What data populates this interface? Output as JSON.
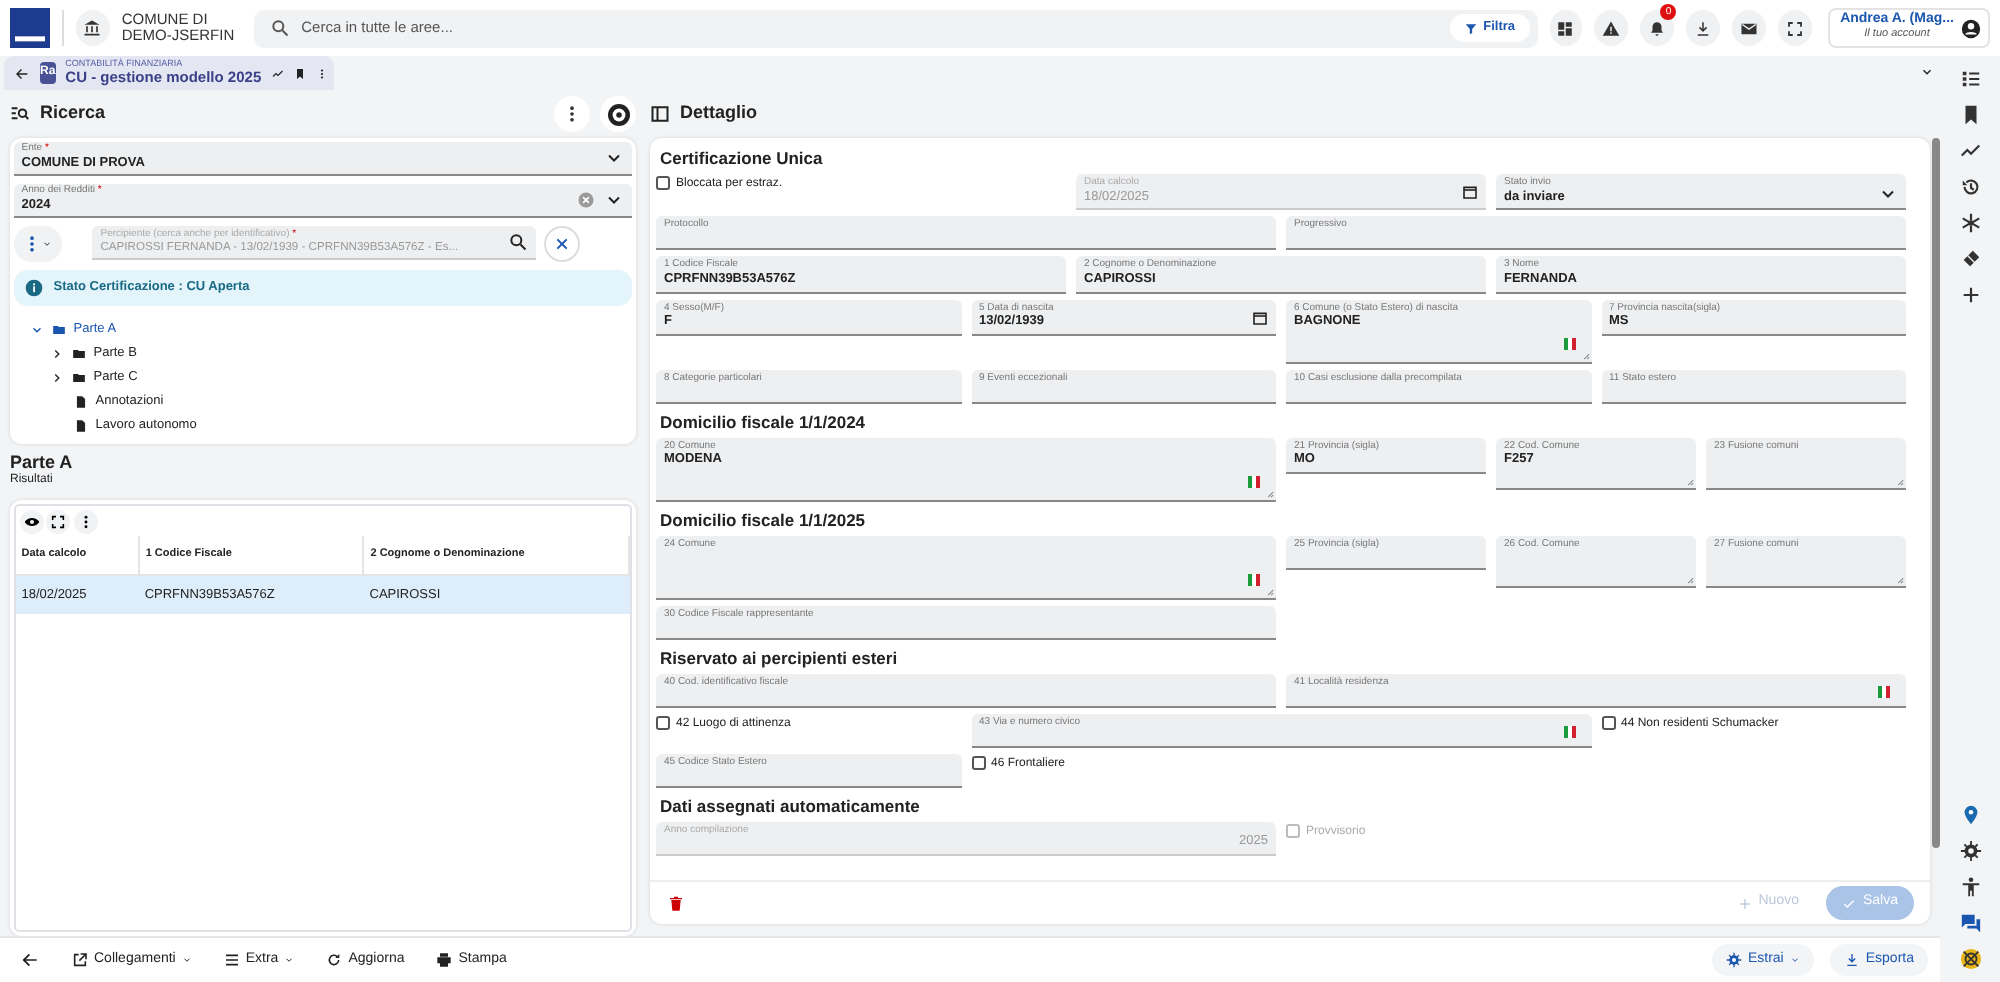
{
  "header": {
    "org_line1": "COMUNE DI",
    "org_line2": "DEMO-JSERFIN",
    "search_placeholder": "Cerca in tutte le aree...",
    "filter_label": "Filtra",
    "notification_count": "0",
    "user_name": "Andrea A. (Mag...",
    "user_subtitle": "Il tuo account"
  },
  "app_tab": {
    "badge": "Ra",
    "category": "CONTABILITÀ FINANZIARIA",
    "title": "CU - gestione modello 2025"
  },
  "search_panel": {
    "title": "Ricerca",
    "ente": {
      "label": "Ente",
      "mark": "*",
      "value": "COMUNE DI PROVA"
    },
    "anno": {
      "label": "Anno dei Redditi",
      "mark": "*",
      "value": "2024"
    },
    "percipiente": {
      "label": "Percipiente (cerca anche per identificativo)",
      "mark": "*",
      "value": "CAPIROSSI FERNANDA - 13/02/1939 - CPRFNN39B53A576Z - Es...",
      "disabled": true
    },
    "status": "Stato Certificazione : CU Aperta",
    "tree": [
      {
        "label": "Parte A",
        "kind": "folder",
        "expanded": true,
        "selected": true,
        "children": [
          {
            "label": "Parte B",
            "kind": "folder",
            "expanded": false,
            "selected": false
          },
          {
            "label": "Parte C",
            "kind": "folder",
            "expanded": false,
            "selected": false
          },
          {
            "label": "Annotazioni",
            "kind": "file",
            "selected": false
          },
          {
            "label": "Lavoro autonomo",
            "kind": "file",
            "selected": false
          }
        ]
      }
    ]
  },
  "results": {
    "title": "Parte A",
    "subtitle": "Risultati",
    "columns": [
      "Data calcolo",
      "1 Codice Fiscale",
      "2 Cognome o Denominazione"
    ],
    "rows": [
      {
        "cells": [
          "18/02/2025",
          "CPRFNN39B53A576Z",
          "CAPIROSSI"
        ],
        "selected": true
      }
    ]
  },
  "detail": {
    "title": "Dettaglio",
    "sections": [
      {
        "heading": "Certificazione Unica",
        "rows": [
          [
            {
              "kind": "checkbox",
              "label": "Bloccata per estraz.",
              "checked": false,
              "disabled": false
            },
            {
              "kind": "date",
              "label": "Data calcolo",
              "value": "18/02/2025",
              "disabled": true
            },
            {
              "kind": "select",
              "label": "Stato invio",
              "value": "da inviare",
              "disabled": false
            }
          ],
          [
            {
              "kind": "text",
              "label": "Protocollo",
              "disabled": false
            },
            {
              "kind": "text",
              "label": "Progressivo",
              "disabled": false
            }
          ],
          [
            {
              "kind": "text",
              "label": "1 Codice Fiscale",
              "value": "CPRFNN39B53A576Z",
              "disabled": false
            },
            {
              "kind": "text",
              "label": "2 Cognome o Denominazione",
              "value": "CAPIROSSI",
              "disabled": false
            },
            {
              "kind": "text",
              "label": "3 Nome",
              "value": "FERNANDA",
              "disabled": false
            }
          ],
          [
            {
              "kind": "text",
              "label": "4 Sesso(M/F)",
              "value": "F",
              "disabled": false
            },
            {
              "kind": "date",
              "label": "5 Data di nascita",
              "value": "13/02/1939",
              "disabled": false
            },
            {
              "kind": "textarea-flag",
              "label": "6 Comune (o Stato Estero) di nascita",
              "value": "BAGNONE",
              "disabled": false
            },
            {
              "kind": "text",
              "label": "7 Provincia nascita(sigla)",
              "value": "MS",
              "disabled": false
            }
          ],
          [
            {
              "kind": "text",
              "label": "8 Categorie particolari",
              "disabled": false
            },
            {
              "kind": "text",
              "label": "9 Eventi eccezionali",
              "disabled": false
            },
            {
              "kind": "text",
              "label": "10 Casi esclusione dalla precompilata",
              "disabled": false
            },
            {
              "kind": "text",
              "label": "11 Stato estero",
              "disabled": false
            }
          ]
        ]
      },
      {
        "heading": "Domicilio fiscale 1/1/2024",
        "rows": [
          [
            {
              "kind": "textarea-flag",
              "label": "20 Comune",
              "value": "MODENA",
              "disabled": false
            },
            {
              "kind": "text",
              "label": "21 Provincia (sigla)",
              "value": "MO",
              "disabled": false
            },
            {
              "kind": "textarea",
              "label": "22 Cod. Comune",
              "value": "F257",
              "disabled": false
            },
            {
              "kind": "textarea",
              "label": "23 Fusione comuni",
              "disabled": false
            }
          ]
        ]
      },
      {
        "heading": "Domicilio fiscale 1/1/2025",
        "rows": [
          [
            {
              "kind": "textarea-flag",
              "label": "24 Comune",
              "disabled": false
            },
            {
              "kind": "text",
              "label": "25 Provincia (sigla)",
              "disabled": false
            },
            {
              "kind": "textarea",
              "label": "26 Cod. Comune",
              "disabled": false
            },
            {
              "kind": "textarea",
              "label": "27 Fusione comuni",
              "disabled": false
            }
          ],
          [
            {
              "kind": "text",
              "label": "30 Codice Fiscale rappresentante",
              "disabled": false
            }
          ]
        ]
      },
      {
        "heading": "Riservato ai percipienti esteri",
        "rows": [
          [
            {
              "kind": "text",
              "label": "40 Cod. identificativo fiscale",
              "disabled": false
            },
            {
              "kind": "text-flag",
              "label": "41 Località residenza",
              "disabled": false
            }
          ],
          [
            {
              "kind": "checkbox",
              "label": "42 Luogo di attinenza",
              "checked": false,
              "disabled": false
            },
            {
              "kind": "text-flag",
              "label": "43 Via e numero civico",
              "disabled": false
            },
            {
              "kind": "checkbox",
              "label": "44 Non residenti Schumacker",
              "checked": false,
              "disabled": false
            }
          ],
          [
            {
              "kind": "text",
              "label": "45 Codice Stato Estero",
              "disabled": false
            },
            {
              "kind": "checkbox",
              "label": "46 Frontaliere",
              "checked": false,
              "disabled": false
            }
          ]
        ]
      },
      {
        "heading": "Dati assegnati automaticamente",
        "rows": [
          [
            {
              "kind": "number",
              "label": "Anno compilazione",
              "value": "2025",
              "disabled": true
            },
            {
              "kind": "checkbox",
              "label": "Provvisorio",
              "checked": false,
              "disabled": true
            }
          ]
        ]
      }
    ],
    "buttons": [
      {
        "label": "Nuovo",
        "disabled": true
      },
      {
        "label": "Salva",
        "disabled": true
      }
    ]
  },
  "bottom_bar": {
    "left": [
      {
        "label": "Collegamenti",
        "dropdown": true
      },
      {
        "label": "Extra",
        "dropdown": true
      },
      {
        "label": "Aggiorna",
        "dropdown": false
      },
      {
        "label": "Stampa",
        "dropdown": false
      }
    ],
    "right": [
      {
        "label": "Estrai",
        "dropdown": true
      },
      {
        "label": "Esporta",
        "dropdown": false
      }
    ]
  }
}
